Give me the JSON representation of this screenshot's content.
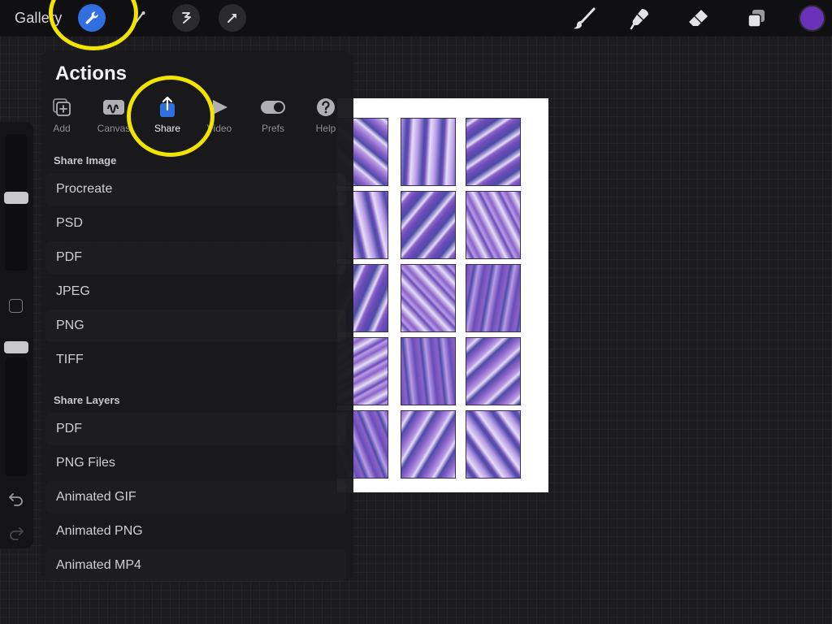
{
  "topbar": {
    "gallery_label": "Gallery",
    "tools_left": [
      "wrench-icon",
      "adjustments-icon",
      "selection-icon",
      "transform-icon"
    ],
    "tools_right": [
      "brush-icon",
      "smudge-icon",
      "eraser-icon",
      "layers-icon"
    ],
    "current_color": "#6a32b8"
  },
  "annotation_color": "#f1e400",
  "actions_panel": {
    "title": "Actions",
    "tabs": [
      {
        "label": "Add",
        "icon": "add-icon"
      },
      {
        "label": "Canvas",
        "icon": "canvas-icon"
      },
      {
        "label": "Share",
        "icon": "share-icon",
        "active": true
      },
      {
        "label": "Video",
        "icon": "video-icon"
      },
      {
        "label": "Prefs",
        "icon": "prefs-toggle-icon"
      },
      {
        "label": "Help",
        "icon": "help-icon"
      }
    ],
    "share_image": {
      "heading": "Share Image",
      "items": [
        "Procreate",
        "PSD",
        "PDF",
        "JPEG",
        "PNG",
        "TIFF"
      ]
    },
    "share_layers": {
      "heading": "Share Layers",
      "items": [
        "PDF",
        "PNG Files",
        "Animated GIF",
        "Animated PNG",
        "Animated MP4"
      ]
    }
  },
  "sidebar": {
    "controls": [
      "brush-size-slider",
      "modify-button",
      "opacity-slider",
      "undo-icon",
      "redo-icon"
    ]
  },
  "artwork": {
    "grid_rows": 5,
    "grid_cols": 3,
    "palette": [
      "#8a63c8",
      "#b79be6",
      "#4d4ba7",
      "#e6dcf7",
      "#6b4bb8"
    ]
  }
}
